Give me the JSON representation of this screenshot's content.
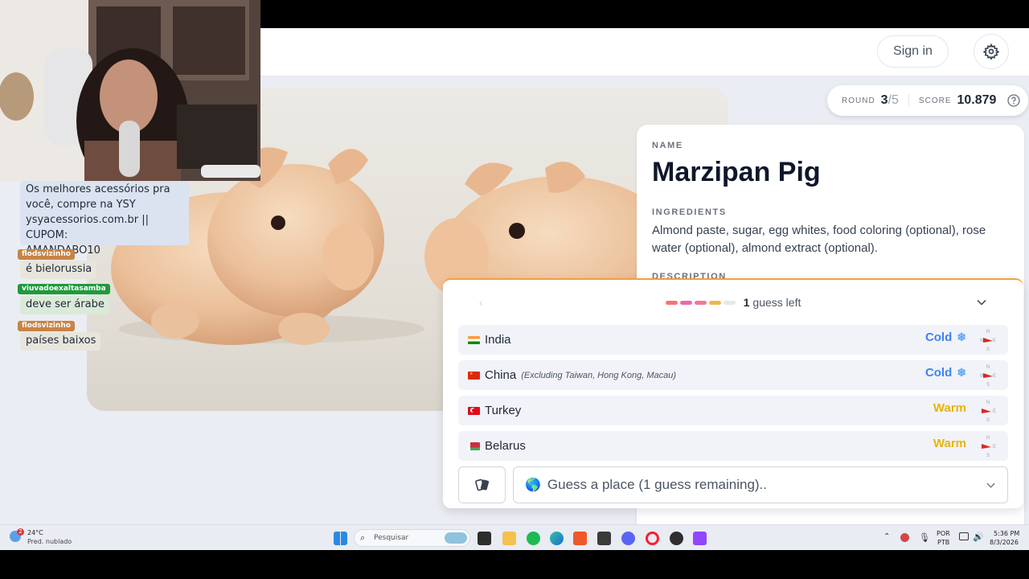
{
  "header": {
    "sign_in": "Sign in"
  },
  "status": {
    "round_label": "ROUND",
    "round_current": "3",
    "round_total": "/5",
    "score_label": "SCORE",
    "score_value": "10.879"
  },
  "info": {
    "name_label": "NAME",
    "name": "Marzipan Pig",
    "ingredients_label": "INGREDIENTS",
    "ingredients": "Almond paste, sugar, egg whites, food coloring (optional), rose water (optional), almond extract (optional).",
    "description_label": "DESCRIPTION"
  },
  "guess_panel": {
    "guesses_left_count": "1",
    "guesses_left_text": "guess left",
    "guess_bars": [
      {
        "state": "used",
        "color": "#f97373"
      },
      {
        "state": "used",
        "color": "#ec6aa8"
      },
      {
        "state": "used",
        "color": "#f27a90"
      },
      {
        "state": "used",
        "color": "#f5b54a"
      },
      {
        "state": "remaining",
        "color": "#e5e7eb"
      }
    ],
    "guesses": [
      {
        "country": "India",
        "note": "",
        "temp": "Cold",
        "temp_icon": "snowflake-icon",
        "temp_color": "#3b82f6"
      },
      {
        "country": "China",
        "note": "(Excluding Taiwan, Hong Kong, Macau)",
        "temp": "Cold",
        "temp_icon": "snowflake-icon",
        "temp_color": "#3b82f6"
      },
      {
        "country": "Turkey",
        "note": "",
        "temp": "Warm",
        "temp_icon": "",
        "temp_color": "#eab308"
      },
      {
        "country": "Belarus",
        "note": "",
        "temp": "Warm",
        "temp_icon": "",
        "temp_color": "#eab308"
      }
    ],
    "compass_letters": {
      "n": "N",
      "e": "E",
      "s": "S",
      "w": "W"
    },
    "input_placeholder": "Guess a place (1 guess remaining).."
  },
  "chat": {
    "sponsor": [
      "Os melhores acessórios pra",
      "você, compre na YSY",
      "ysyacessorios.com.br || CUPOM:",
      "AMANDABO10"
    ],
    "messages": [
      {
        "user": "flodsvizinho",
        "text": "é bielorussia",
        "tag_color": "#c78446"
      },
      {
        "user": "viuvadoexaltasamba",
        "text": "deve ser árabe",
        "tag_color": "#1f9a3b"
      },
      {
        "user": "flodsvizinho",
        "text": "países baixos",
        "tag_color": "#c78446"
      }
    ]
  },
  "taskbar": {
    "weather_temp": "24°C",
    "weather_desc": "Pred. nublado",
    "weather_badge": "2",
    "search_placeholder": "Pesquisar",
    "lang_top": "POR",
    "lang_bottom": "PTB",
    "time": "5:36 PM",
    "date": "8/3/2026"
  }
}
